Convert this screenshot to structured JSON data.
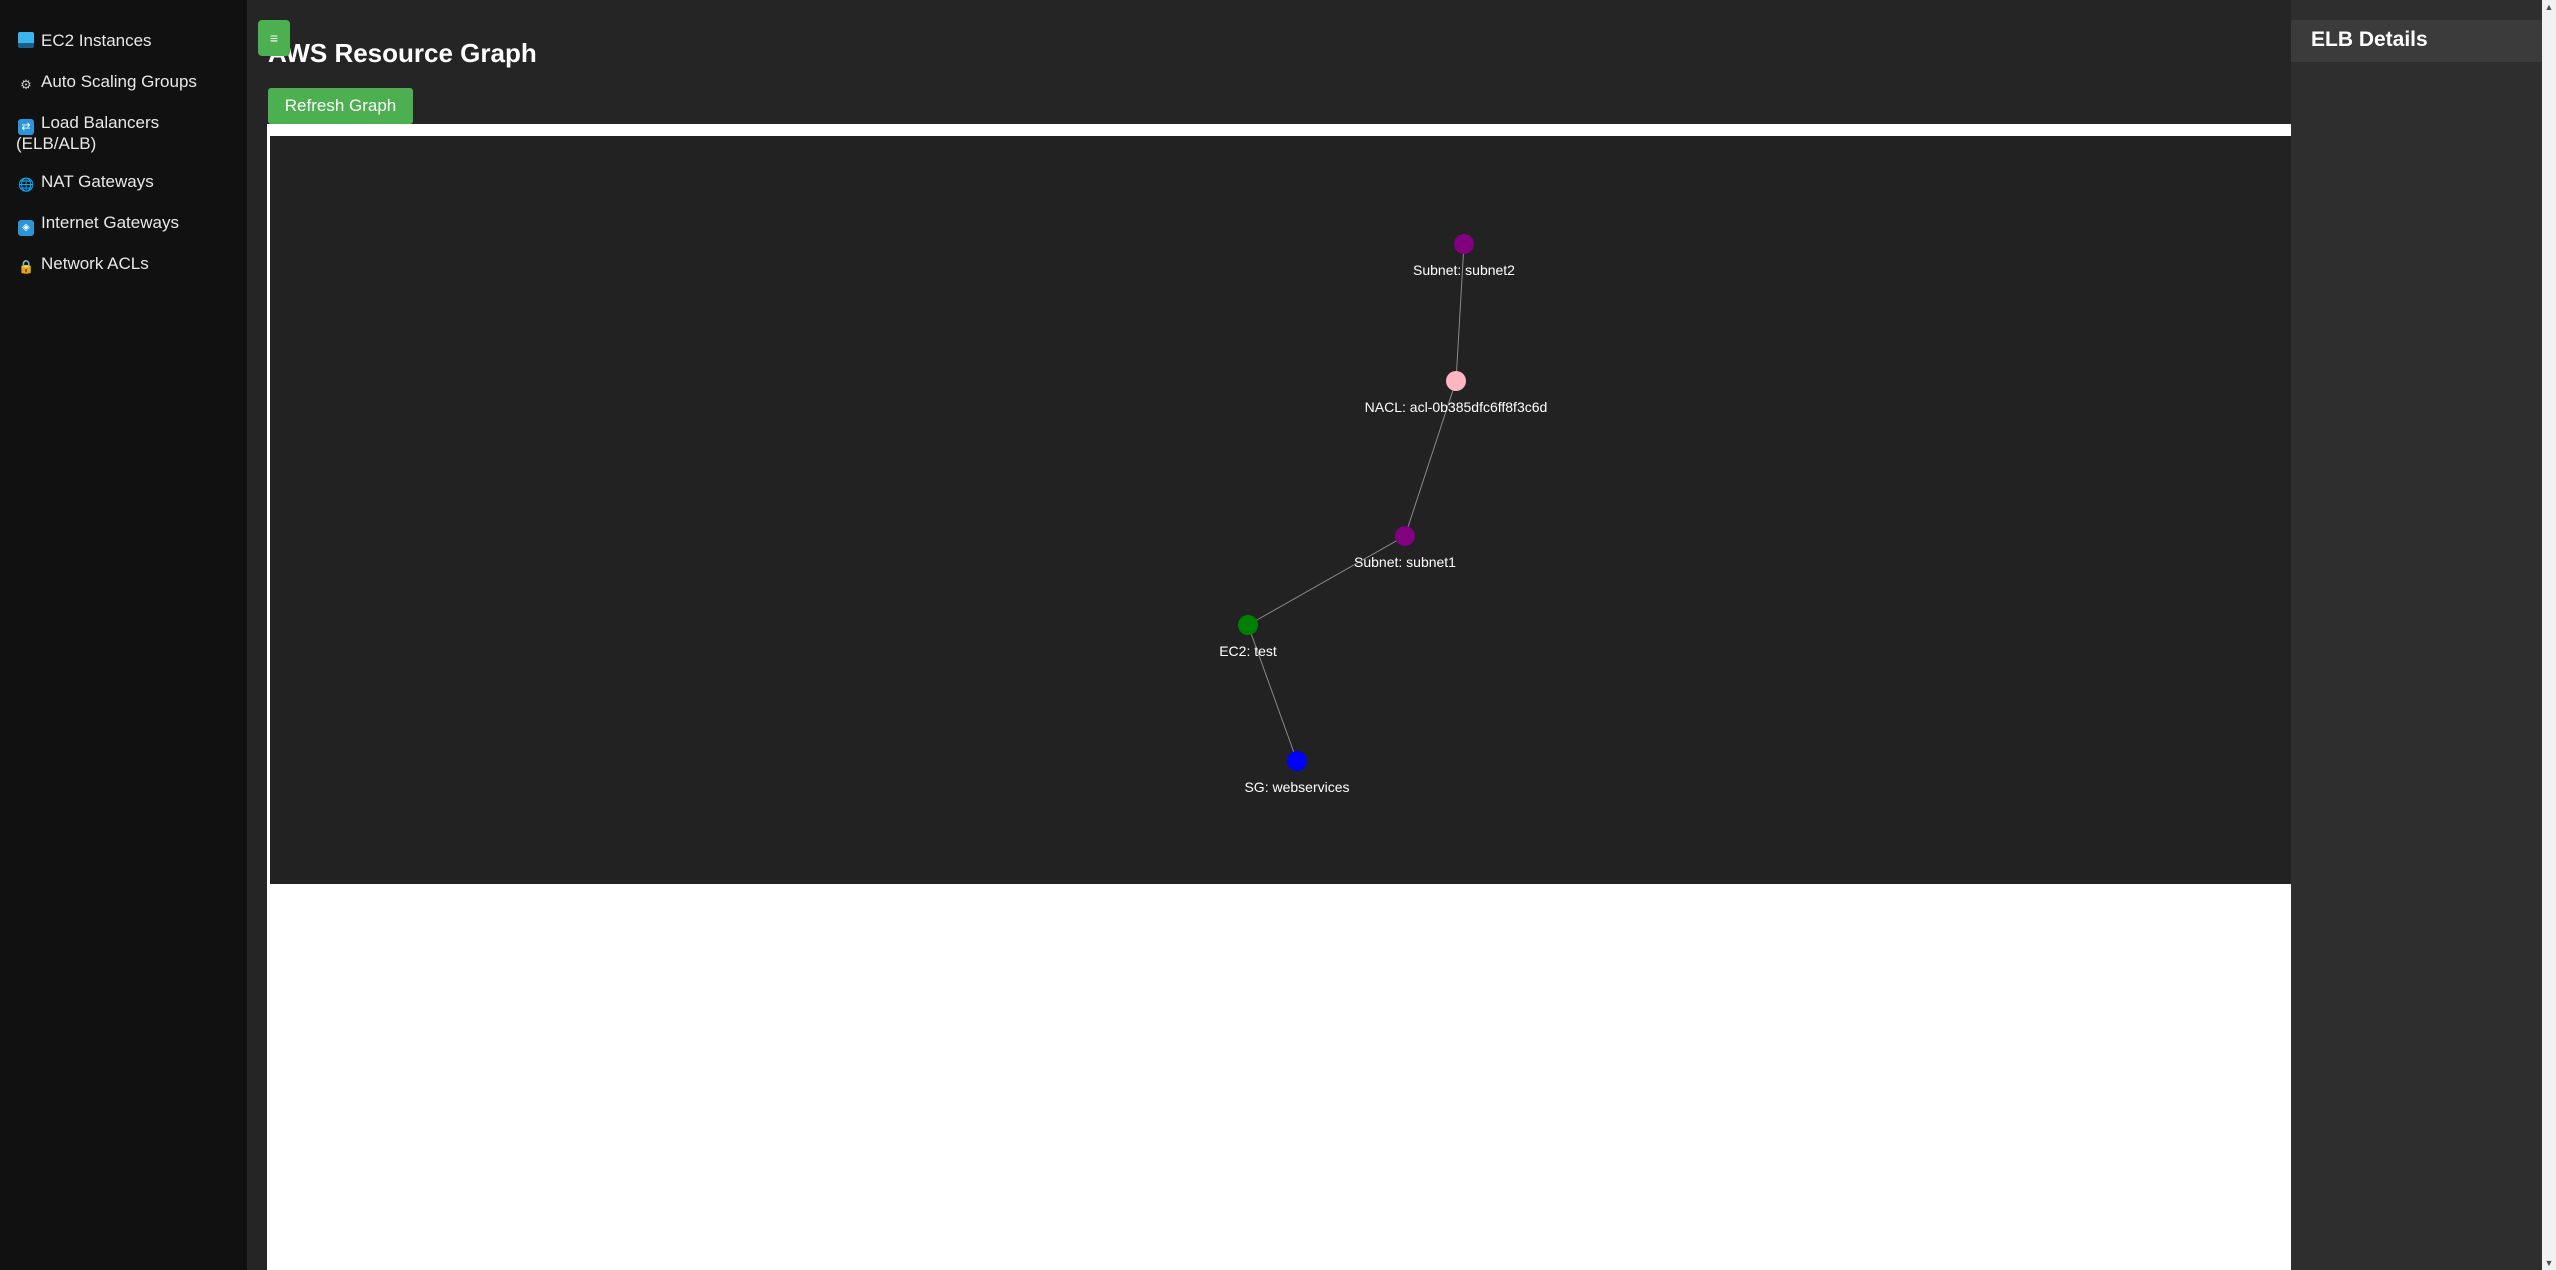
{
  "sidebar": {
    "items": [
      {
        "label": "EC2 Instances",
        "icon": "ec2-icon"
      },
      {
        "label": "Auto Scaling Groups",
        "icon": "gear-icon"
      },
      {
        "label_line1": "Load Balancers",
        "label_line2": "(ELB/ALB)",
        "icon": "load-balancer-icon"
      },
      {
        "label": "NAT Gateways",
        "icon": "globe-icon"
      },
      {
        "label": "Internet Gateways",
        "icon": "internet-gateway-icon"
      },
      {
        "label": "Network ACLs",
        "icon": "lock-icon"
      }
    ]
  },
  "header": {
    "menu_icon": "≡",
    "title": "AWS Resource Graph",
    "refresh_label": "Refresh Graph"
  },
  "graph": {
    "nodes": [
      {
        "id": "subnet2",
        "label": "Subnet: subnet2",
        "color": "#800080"
      },
      {
        "id": "nacl",
        "label": "NACL: acl-0b385dfc6ff8f3c6d",
        "color": "#ffb6c1"
      },
      {
        "id": "subnet1",
        "label": "Subnet: subnet1",
        "color": "#800080"
      },
      {
        "id": "ec2",
        "label": "EC2: test",
        "color": "#008000"
      },
      {
        "id": "sg",
        "label": "SG: webservices",
        "color": "#0000ff"
      }
    ],
    "edges": [
      [
        "subnet2",
        "nacl"
      ],
      [
        "nacl",
        "subnet1"
      ],
      [
        "subnet1",
        "ec2"
      ],
      [
        "ec2",
        "sg"
      ]
    ]
  },
  "details": {
    "title": "ELB Details"
  },
  "colors": {
    "accent": "#4caf50",
    "sidebar_bg": "#111111",
    "main_bg": "#252525",
    "graph_bg": "#222222",
    "panel_bg": "#2e2e2e"
  }
}
